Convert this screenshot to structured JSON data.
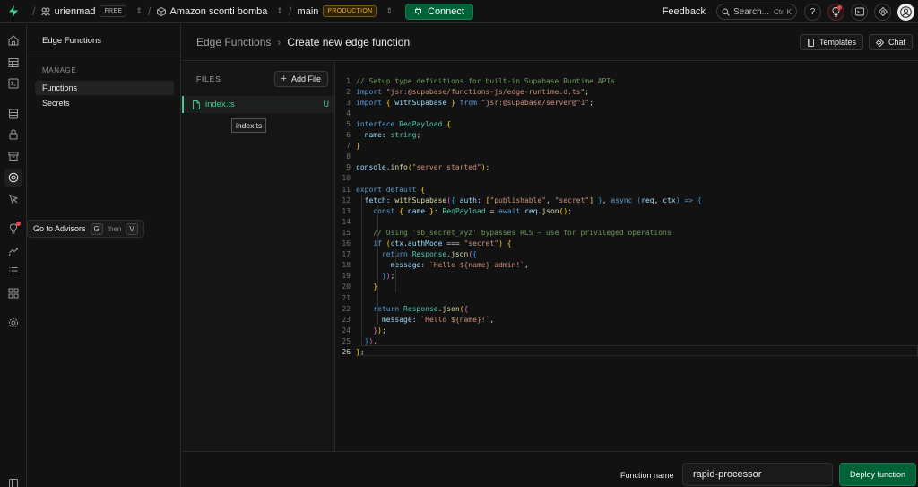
{
  "colors": {
    "accent_green": "#3ecf8e",
    "button_green": "#006239",
    "production_badge": "#f0a830",
    "background": "#121212"
  },
  "topbar": {
    "org_name": "urienmad",
    "org_plan": "FREE",
    "project_name": "Amazon sconti bomba",
    "branch_name": "main",
    "branch_badge": "PRODUCTION",
    "connect_label": "Connect",
    "feedback_label": "Feedback",
    "search_placeholder": "Search...",
    "search_shortcut": "Ctrl K",
    "icons": [
      "supabase-logo-icon",
      "org-icon",
      "project-cube-icon",
      "branch-icon",
      "plug-icon",
      "help-icon",
      "lightbulb-icon",
      "terminal-icon",
      "assistant-icon",
      "avatar-icon"
    ]
  },
  "rail": {
    "icons": [
      "home-icon",
      "table-editor-icon",
      "sql-editor-icon",
      "database-icon",
      "auth-lock-icon",
      "storage-box-icon",
      "edge-functions-icon",
      "realtime-cursor-icon",
      "advisors-lightbulb-icon",
      "reports-icon",
      "logs-icon",
      "integrations-icon",
      "settings-gear-icon",
      "collapse-sidebar-icon"
    ]
  },
  "tooltip": {
    "text": "Go to Advisors",
    "key1": "G",
    "then": "then",
    "key2": "V"
  },
  "sidenav": {
    "title": "Edge Functions",
    "section": "MANAGE",
    "items": [
      "Functions",
      "Secrets"
    ]
  },
  "header": {
    "breadcrumb_parent": "Edge Functions",
    "breadcrumb_current": "Create new edge function",
    "templates_label": "Templates",
    "chat_label": "Chat"
  },
  "files": {
    "label": "FILES",
    "add_file_label": "Add File",
    "file_name": "index.ts",
    "file_status": "U",
    "tooltip": "index.ts"
  },
  "editor": {
    "current_line": 26,
    "lines": [
      "// Setup type definitions for built-in Supabase Runtime APIs",
      "import \"jsr:@supabase/functions-js/edge-runtime.d.ts\";",
      "import { withSupabase } from \"jsr:@supabase/server@^1\";",
      "",
      "interface ReqPayload {",
      "  name: string;",
      "}",
      "",
      "console.info(\"server started\");",
      "",
      "export default {",
      "  fetch: withSupabase({ auth: [\"publishable\", \"secret\"] }, async (req, ctx) => {",
      "    const { name }: ReqPayload = await req.json();",
      "",
      "    // Using 'sb_secret_xyz' bypasses RLS — use for privileged operations",
      "    if (ctx.authMode === \"secret\") {",
      "      return Response.json({",
      "        message: `Hello ${name} admin!`,",
      "      });",
      "    }",
      "",
      "    return Response.json({",
      "      message: `Hello ${name}!`,",
      "    });",
      "  }),",
      "};"
    ]
  },
  "footer": {
    "function_name_label": "Function name",
    "function_name_value": "rapid-processor",
    "deploy_label": "Deploy function"
  }
}
